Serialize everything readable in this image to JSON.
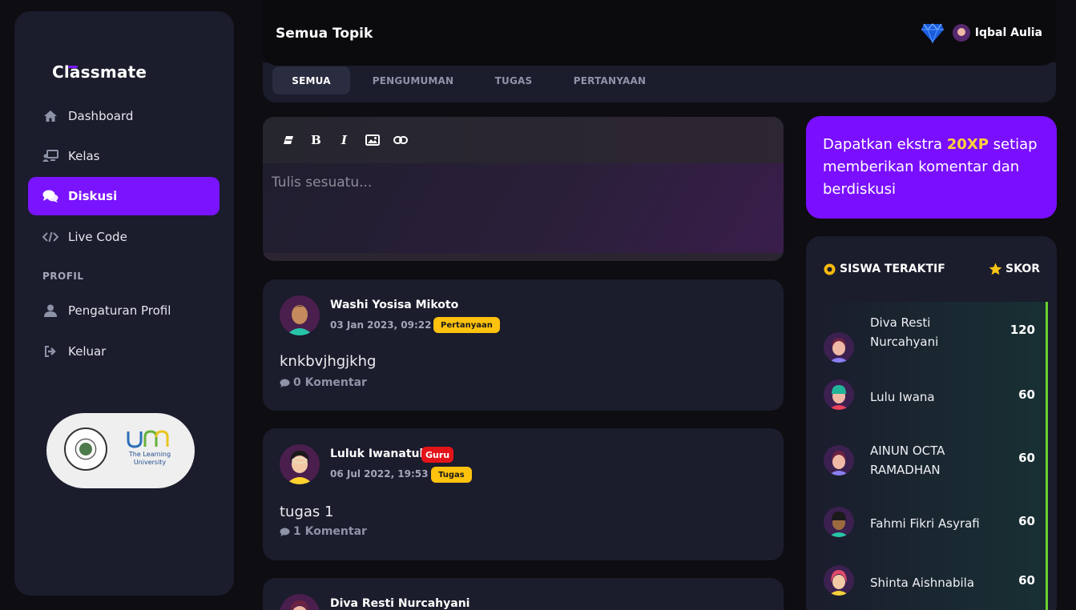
{
  "app": {
    "brand": "Classmate"
  },
  "sidebar": {
    "items": [
      {
        "label": "Dashboard",
        "icon": "home-icon"
      },
      {
        "label": "Kelas",
        "icon": "class-icon"
      },
      {
        "label": "Diskusi",
        "icon": "chat-icon",
        "active": true
      },
      {
        "label": "Live Code",
        "icon": "code-icon"
      }
    ],
    "section_label": "PROFIL",
    "profile_items": [
      {
        "label": "Pengaturan Profil",
        "icon": "user-icon"
      },
      {
        "label": "Keluar",
        "icon": "logout-icon"
      }
    ],
    "partner": {
      "tagline": "The Learning University"
    }
  },
  "header": {
    "title": "Semua Topik",
    "user_name": "Iqbal Aulia"
  },
  "tabs": [
    {
      "label": "SEMUA",
      "active": true
    },
    {
      "label": "PENGUMUMAN"
    },
    {
      "label": "TUGAS"
    },
    {
      "label": "PERTANYAAN"
    }
  ],
  "editor": {
    "placeholder": "Tulis sesuatu..."
  },
  "posts": [
    {
      "author": "Washi Yosisa Mikoto",
      "date": "03 Jan 2023, 09:22",
      "tag": "Pertanyaan",
      "content": "knkbvjhgjkhg",
      "comments": "0 Komentar"
    },
    {
      "author": "Luluk Iwanatul",
      "role": "Guru",
      "date": "06 Jul 2022, 19:53",
      "tag": "Tugas",
      "content": "tugas 1",
      "comments": "1 Komentar"
    },
    {
      "author": "Diva Resti Nurcahyani"
    }
  ],
  "promo": {
    "text_before": "Dapatkan ekstra ",
    "highlight": "20XP",
    "text_after": " setiap memberikan komentar dan berdiskusi"
  },
  "leaderboard": {
    "title": "SISWA TERAKTIF",
    "score_label": "SKOR",
    "rows": [
      {
        "name": "Diva Resti Nurcahyani",
        "score": "120"
      },
      {
        "name": "Lulu Iwana",
        "score": "60"
      },
      {
        "name": "AINUN OCTA RAMADHAN",
        "score": "60"
      },
      {
        "name": "Fahmi Fikri Asyrafi",
        "score": "60"
      },
      {
        "name": "Shinta Aishnabila",
        "score": "60"
      }
    ]
  },
  "colors": {
    "accent": "#7a14ff",
    "tag_yellow": "#ffc20e",
    "guru_red": "#e2141a",
    "rank_bar": "#69d12f"
  }
}
